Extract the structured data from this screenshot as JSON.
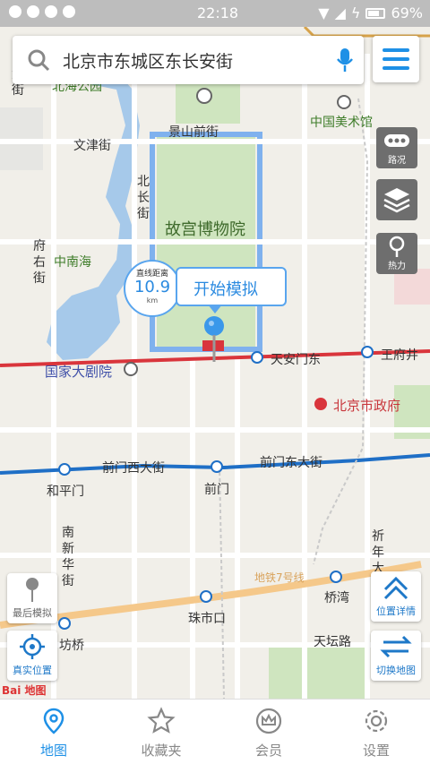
{
  "status_bar": {
    "time": "22:18",
    "battery": "69%"
  },
  "search": {
    "query": "北京市东城区东长安街",
    "icon": "search-icon",
    "voice_icon": "mic-icon"
  },
  "menu": {
    "icon": "menu-icon"
  },
  "tools": {
    "traffic": "路况",
    "layers_icon": "layers-icon",
    "heat": "热力"
  },
  "pin": {
    "action_label": "开始模拟",
    "distance_label": "直线距离",
    "distance_value": "10.9",
    "distance_unit": "km"
  },
  "map_labels": {
    "forbidden_city": "故宫博物院",
    "jingshan": "景山前街",
    "wenjin": "文津街",
    "art_museum": "中国美术馆",
    "beihai": "北海公园",
    "zhongnanhai": "中南海",
    "theater": "国家大剧院",
    "tiananmen_east": "天安门东",
    "wangfujing": "王府井",
    "gov": "北京市政府",
    "qianmen_west": "前门西大街",
    "qianmen_east": "前门东大街",
    "qianmen": "前门",
    "hepingmen": "和平门",
    "zhushikou": "珠市口",
    "qiaowan": "桥湾",
    "tiantan": "天坛路",
    "hufang": "坊桥",
    "line7": "地铁7号线",
    "beichang": "北长街",
    "fuyou": "府右街",
    "nanxinhua": "南新华街",
    "qiannian": "祈年大",
    "xida": "大街"
  },
  "side_buttons": {
    "last_sim": "最后模拟",
    "real_location": "真实位置",
    "location_detail": "位置详情",
    "switch_map": "切换地图"
  },
  "logo": "Bai 地图",
  "nav": [
    {
      "label": "地图",
      "icon": "map-pin-icon",
      "active": true
    },
    {
      "label": "收藏夹",
      "icon": "star-icon",
      "active": false
    },
    {
      "label": "会员",
      "icon": "crown-icon",
      "active": false
    },
    {
      "label": "设置",
      "icon": "gear-icon",
      "active": false
    }
  ],
  "colors": {
    "accent": "#1e90e6",
    "metro_red": "#d9353c",
    "metro_blue": "#1f6fc6",
    "park_green": "#cfe5bf",
    "water": "#a6c9ea"
  }
}
